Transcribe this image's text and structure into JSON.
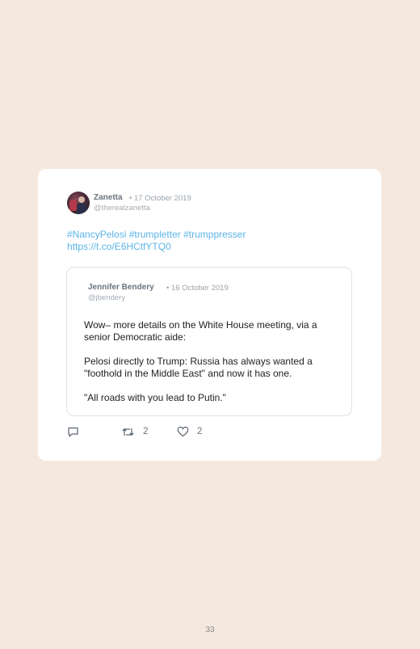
{
  "tweet": {
    "author_name": "Zanetta",
    "date": "• 17 October 2019",
    "handle": "@therealzanetta",
    "hashtags": [
      "#NancyPelosi",
      "#trumpletter",
      "#trumppresser"
    ],
    "link": "https://t.co/E6HCtfYTQ0",
    "quoted": {
      "author_name": "Jennifer Bendery",
      "date": "• 16 October 2019",
      "handle": "@jbendery",
      "paragraphs": [
        "Wow– more details on the White House meeting, via a senior Democratic aide:",
        "Pelosi directly to Trump: Russia has always wanted a \"foothold in the Middle East\" and now it has one.",
        "\"All roads with you lead to Putin.\""
      ]
    },
    "actions": {
      "reply_icon": "reply-icon",
      "retweet_icon": "retweet-icon",
      "retweet_count": "2",
      "like_icon": "heart-icon",
      "like_count": "2"
    }
  },
  "page_number": "33",
  "colors": {
    "background": "#f5e9df",
    "card": "#ffffff",
    "link": "#5ab4e8"
  }
}
